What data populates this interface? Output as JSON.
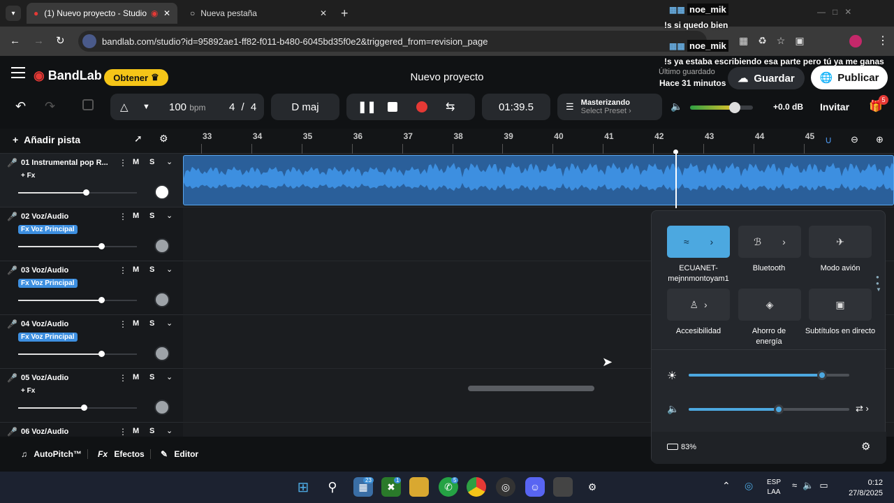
{
  "browser": {
    "tab_active_title": "(1) Nuevo proyecto - Studio",
    "tab_inactive_title": "Nueva pestaña",
    "url": "bandlab.com/studio?id=95892ae1-ff82-f011-b480-6045bd35f0e2&triggered_from=revision_page"
  },
  "chat": {
    "messages": [
      {
        "user": "noe_mik",
        "text": "!s si quedo bien"
      },
      {
        "user": "noe_mik",
        "text": "!s ya estaba escribiendo esa parte pero tú ya me ganas"
      }
    ]
  },
  "header": {
    "logo": "BandLab",
    "obtener_label": "Obtener",
    "project_title": "Nuevo proyecto",
    "last_saved_label": "Último guardado",
    "last_saved_time": "Hace 31 minutos",
    "save_label": "Guardar",
    "publish_label": "Publicar"
  },
  "transport": {
    "bpm": "100",
    "bpm_unit": "bpm",
    "time_sig_num": "4",
    "time_sig_sep": "/",
    "time_sig_den": "4",
    "key": "D maj",
    "time": "01:39.5",
    "mastering_title": "Masterizando",
    "mastering_preset": "Select Preset",
    "volume_db": "+0.0 dB",
    "master_volume": 0.7,
    "invite_label": "Invitar",
    "gift_badge": "5"
  },
  "sidebar": {
    "add_track_label": "Añadir pista"
  },
  "ruler": {
    "ticks": [
      "33",
      "34",
      "35",
      "36",
      "37",
      "38",
      "39",
      "40",
      "41",
      "42",
      "43",
      "44",
      "45"
    ]
  },
  "tracks": [
    {
      "name": "01  Instrumental pop R...",
      "fx": "+ Fx",
      "fx_style": "plain",
      "mute": "M",
      "solo": "S",
      "volume": 0.57,
      "mic_color": "#4a90e2"
    },
    {
      "name": "02  Voz/Audio",
      "fx": "Fx Voz Principal",
      "fx_style": "tag",
      "mute": "M",
      "solo": "S",
      "volume": 0.7,
      "mic_color": "#4a90e2"
    },
    {
      "name": "03  Voz/Audio",
      "fx": "Fx Voz Principal",
      "fx_style": "tag",
      "mute": "M",
      "solo": "S",
      "volume": 0.7,
      "mic_color": "#4a90e2"
    },
    {
      "name": "04  Voz/Audio",
      "fx": "Fx Voz Principal",
      "fx_style": "tag",
      "mute": "M",
      "solo": "S",
      "volume": 0.7,
      "mic_color": "#4a90e2"
    },
    {
      "name": "05  Voz/Audio",
      "fx": "+ Fx",
      "fx_style": "plain",
      "mute": "M",
      "solo": "S",
      "volume": 0.55,
      "mic_color": "#e04545"
    },
    {
      "name": "06  Voz/Audio",
      "fx": "",
      "fx_style": "plain",
      "mute": "M",
      "solo": "S",
      "volume": 0.55,
      "mic_color": "#4a90e2"
    }
  ],
  "bottom_tools": {
    "autopitch": "AutoPitch™",
    "effects_prefix": "Fx",
    "effects": "Efectos",
    "editor": "Editor"
  },
  "quick_settings": {
    "wifi_label": "ECUANET-mejnnmontoyam1",
    "bluetooth_label": "Bluetooth",
    "airplane_label": "Modo avión",
    "accessibility_label": "Accesibilidad",
    "energy_label": "Ahorro de energía",
    "captions_label": "Subtítulos en directo",
    "brightness": 0.83,
    "volume": 0.56,
    "battery": "83%"
  },
  "taskbar": {
    "badge_1": "23",
    "badge_2": "1",
    "badge_3": "5",
    "lang_1": "ESP",
    "lang_2": "LAA",
    "time": "0:12",
    "date": "27/8/2025"
  },
  "colors": {
    "accent_blue": "#4a90e2",
    "waveform": "#3d8fe0",
    "obtener_yellow": "#f5c518",
    "record_red": "#e53935"
  }
}
